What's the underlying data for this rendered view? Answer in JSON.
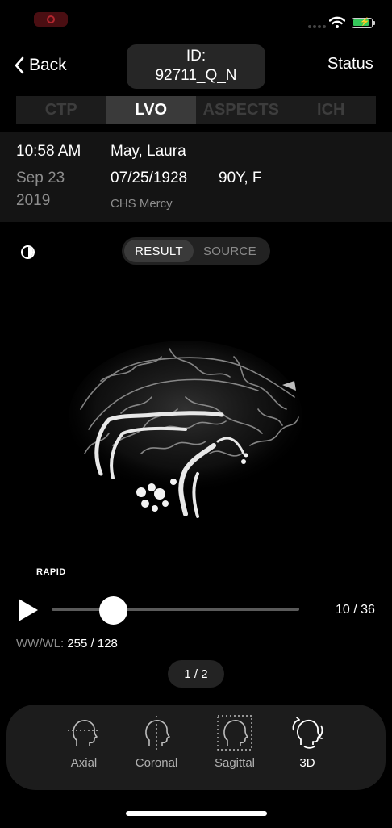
{
  "header": {
    "back_label": "Back",
    "id_label": "ID:",
    "id_value": "92711_Q_N",
    "status_label": "Status"
  },
  "tabs": [
    {
      "label": "CTP",
      "active": false
    },
    {
      "label": "LVO",
      "active": true
    },
    {
      "label": "ASPECTS",
      "active": false
    },
    {
      "label": "ICH",
      "active": false
    }
  ],
  "study": {
    "time": "10:58 AM",
    "date_line1": "Sep 23",
    "date_line2": "2019",
    "patient_name": "May, Laura",
    "dob": "07/25/1928",
    "age_sex": "90Y, F",
    "site": "CHS Mercy"
  },
  "view_toggle": {
    "options": [
      "RESULT",
      "SOURCE"
    ],
    "selected": "RESULT"
  },
  "viewer": {
    "brand": "RAPID",
    "counter": "10 / 36",
    "slice_position": 0.25,
    "wwwl_label": "WW/WL:",
    "wwwl_value": "255 / 128",
    "page": "1 / 2"
  },
  "dock": {
    "items": [
      {
        "label": "Axial",
        "icon": "axial-head-icon",
        "active": false
      },
      {
        "label": "Coronal",
        "icon": "coronal-head-icon",
        "active": false
      },
      {
        "label": "Sagittal",
        "icon": "sagittal-head-icon",
        "active": false
      },
      {
        "label": "3D",
        "icon": "3d-head-icon",
        "active": true
      }
    ]
  },
  "colors": {
    "background": "#000000",
    "panel": "#141414",
    "tab_active": "#3a3a3a",
    "battery": "#34c759"
  }
}
